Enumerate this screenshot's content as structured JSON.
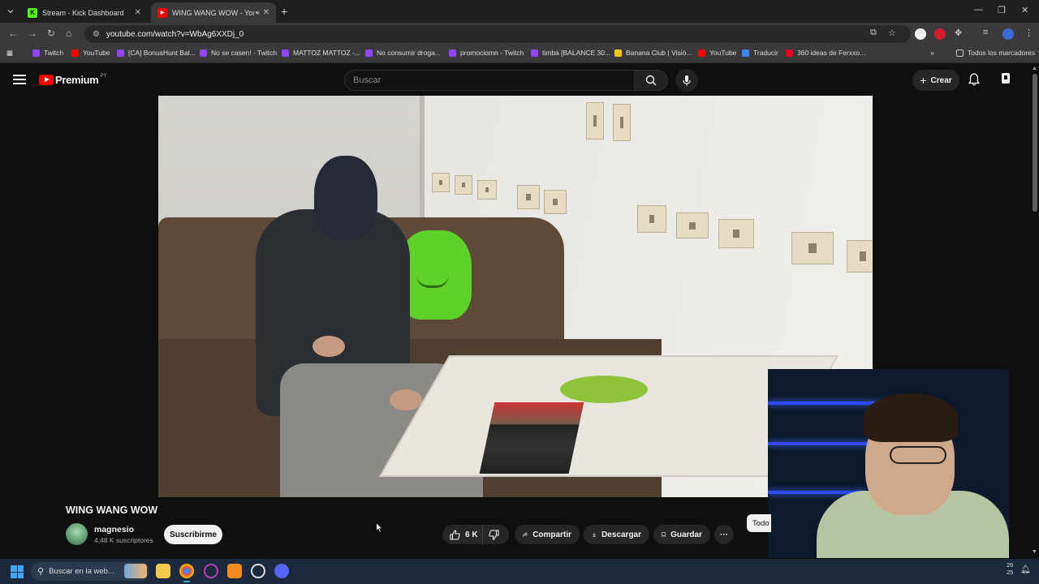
{
  "browser": {
    "tabs": [
      {
        "title": "Stream - Kick Dashboard",
        "favicon": "kick-icon",
        "active": false
      },
      {
        "title": "WING WANG WOW - YouTube",
        "favicon": "youtube-icon",
        "active": true
      }
    ],
    "url": "youtube.com/watch?v=WbAg6XXDj_0",
    "bookmarks": [
      {
        "label": "Twitch",
        "icon": "twitch-icon"
      },
      {
        "label": "YouTube",
        "icon": "youtube-icon"
      },
      {
        "label": "[CA] BonusHunt Bal...",
        "icon": "twitch-icon"
      },
      {
        "label": "No se casen! - Twitch",
        "icon": "twitch-icon"
      },
      {
        "label": "MATTOZ MATTOZ -...",
        "icon": "twitch-icon"
      },
      {
        "label": "No consumir droga...",
        "icon": "twitch-icon"
      },
      {
        "label": "promociomn - Twitch",
        "icon": "twitch-icon"
      },
      {
        "label": "timba [BALANCE 30...",
        "icon": "twitch-icon"
      },
      {
        "label": "Banana Club | Visió...",
        "icon": "banana-icon"
      },
      {
        "label": "YouTube",
        "icon": "youtube-icon"
      },
      {
        "label": "Traducir",
        "icon": "translate-icon"
      },
      {
        "label": "360 ideas de Ferxxo...",
        "icon": "pinterest-icon"
      }
    ],
    "all_bookmarks": "Todos los marcadores"
  },
  "youtube": {
    "logo": "Premium",
    "region": "PY",
    "search_placeholder": "Buscar",
    "create_label": "Crear",
    "video": {
      "title": "WING WANG WOW",
      "channel": "magnesio",
      "subscribers": "4,48 K suscriptores",
      "subscribe_label": "Suscribirme",
      "likes": "6 K",
      "share_label": "Compartir",
      "download_label": "Descargar",
      "save_label": "Guardar"
    },
    "chip_label": "Todo"
  },
  "taskbar": {
    "search_placeholder": "Buscar en la web...",
    "clock_line1": "26",
    "clock_line2": "25"
  },
  "colors": {
    "youtube_red": "#ff0000",
    "kick_green": "#53fc18",
    "twitch_purple": "#9146ff",
    "background": "#0f0f0f"
  }
}
